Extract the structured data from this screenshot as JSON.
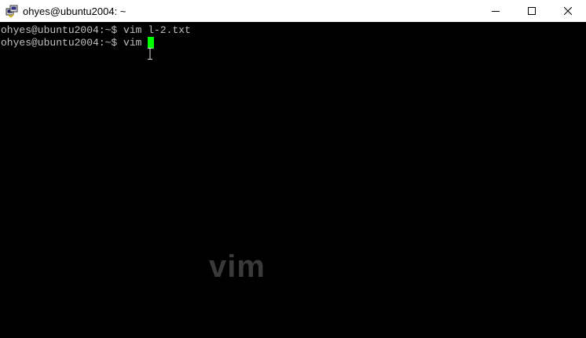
{
  "window": {
    "title": "ohyes@ubuntu2004: ~",
    "app_icon": "putty-icon",
    "controls": {
      "minimize_icon": "minimize-icon",
      "maximize_icon": "maximize-icon",
      "close_icon": "close-icon"
    }
  },
  "terminal": {
    "lines": [
      {
        "prompt": "ohyes@ubuntu2004:~$ ",
        "command": "vim l-2.txt"
      },
      {
        "prompt": "ohyes@ubuntu2004:~$ ",
        "command": "vim "
      }
    ],
    "cursor_color": "#00ff00",
    "text_color": "#c0c0c0",
    "background": "#000000"
  },
  "overlay": {
    "watermark_text": "vim"
  }
}
